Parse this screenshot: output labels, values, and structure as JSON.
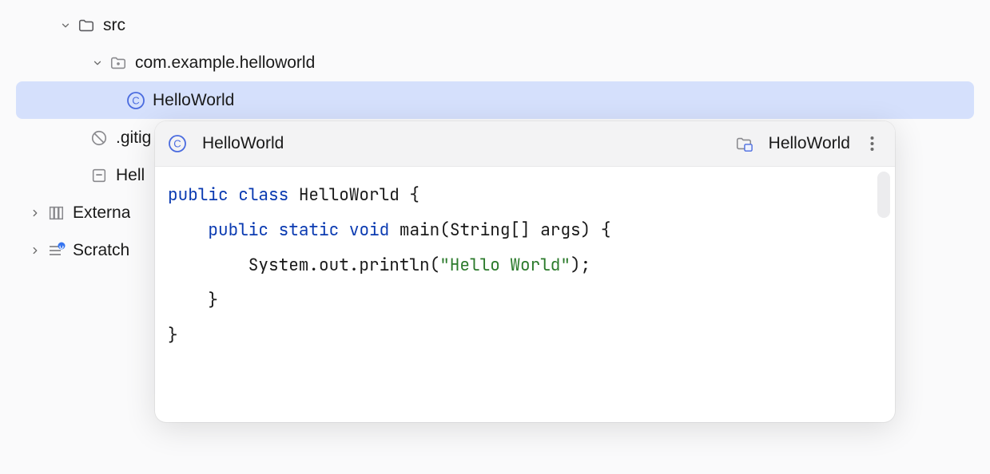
{
  "tree": {
    "src": "src",
    "package": "com.example.helloworld",
    "class_file": "HelloWorld",
    "gitignore_partial": ".gitig",
    "iml_partial": "Hell",
    "external_partial": "Externa",
    "scratch_partial": "Scratch"
  },
  "preview": {
    "title": "HelloWorld",
    "module": "HelloWorld"
  },
  "code": {
    "l1a": "public",
    "l1b": " ",
    "l1c": "class",
    "l1d": " HelloWorld {",
    "l2a": "    ",
    "l2b": "public",
    "l2c": " ",
    "l2d": "static",
    "l2e": " ",
    "l2f": "void",
    "l2g": " main(String[] args) {",
    "l3a": "        System.out.println(",
    "l3b": "\"Hello World\"",
    "l3c": ");",
    "l4": "    }",
    "l5": "}"
  }
}
